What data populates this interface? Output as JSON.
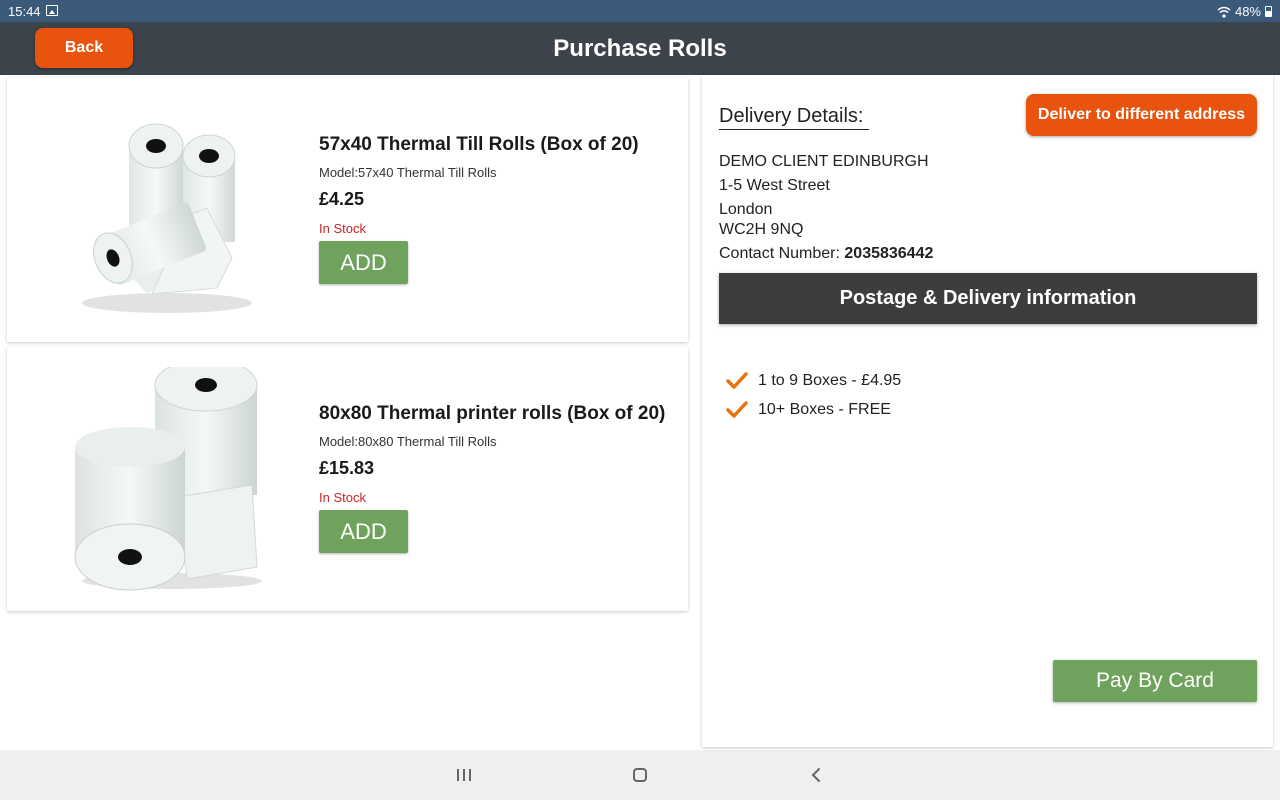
{
  "status_bar": {
    "time": "15:44",
    "battery": "48%",
    "icons": [
      "image-icon",
      "wifi-icon",
      "battery-icon"
    ]
  },
  "header": {
    "back_label": "Back",
    "title": "Purchase Rolls"
  },
  "products": [
    {
      "name": "57x40 Thermal Till Rolls (Box of 20)",
      "model": "Model:57x40 Thermal Till Rolls",
      "price": "£4.25",
      "stock": "In Stock",
      "add_label": "ADD"
    },
    {
      "name": "80x80 Thermal printer rolls (Box of 20)",
      "model": "Model:80x80 Thermal Till Rolls",
      "price": "£15.83",
      "stock": "In Stock",
      "add_label": "ADD"
    }
  ],
  "delivery": {
    "heading": "Delivery Details:",
    "different_address_label": "Deliver to different address",
    "address": [
      "DEMO CLIENT EDINBURGH",
      "1-5 West Street",
      "London",
      "WC2H 9NQ"
    ],
    "contact_label": "Contact Number:",
    "contact_number": "2035836442",
    "postage_label": "Postage & Delivery information",
    "shipping_options": [
      "1 to 9 Boxes - £4.95",
      "10+ Boxes - FREE"
    ],
    "pay_label": "Pay By Card"
  },
  "colors": {
    "header_bg": "#3d434b",
    "accent_orange": "#e8530e",
    "button_green": "#6fa35d",
    "stock_red": "#c62828",
    "postage_bar_bg": "#3d3d3d"
  }
}
